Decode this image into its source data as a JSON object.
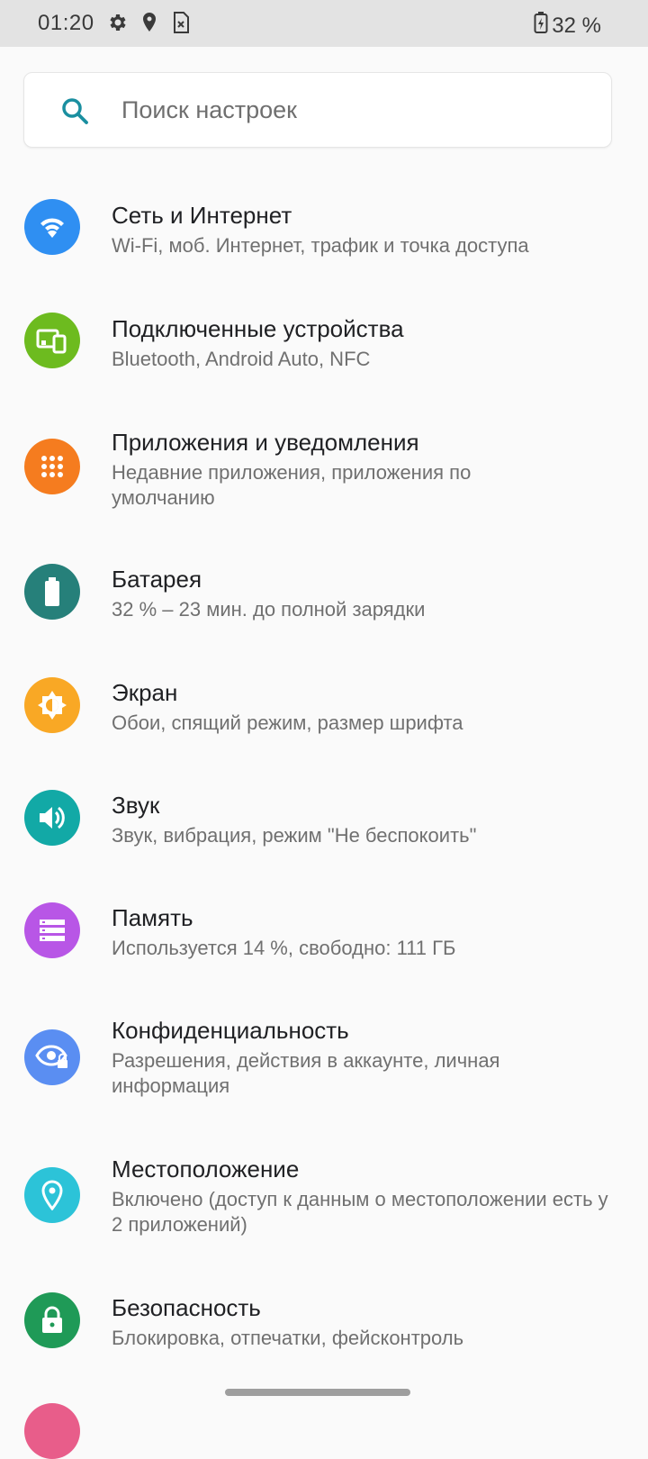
{
  "status_bar": {
    "time": "01:20",
    "battery_text": "32 %",
    "icons": [
      "gear-icon",
      "location-pin-icon",
      "sim-card-icon",
      "battery-charging-icon"
    ]
  },
  "search": {
    "placeholder": "Поиск настроек",
    "icon": "search-icon",
    "accent": "#1a8fa0"
  },
  "settings": {
    "items": [
      {
        "title": "Сеть и Интернет",
        "subtitle": "Wi-Fi, моб. Интернет, трафик и точка доступа",
        "icon": "wifi-icon",
        "color": "#2f8ff2"
      },
      {
        "title": "Подключенные устройства",
        "subtitle": "Bluetooth, Android Auto, NFC",
        "icon": "devices-icon",
        "color": "#6dbb1f"
      },
      {
        "title": "Приложения и уведомления",
        "subtitle": "Недавние приложения, приложения по умолчанию",
        "icon": "apps-grid-icon",
        "color": "#f57c1f"
      },
      {
        "title": "Батарея",
        "subtitle": "32 % – 23 мин. до полной зарядки",
        "icon": "battery-icon",
        "color": "#26807a"
      },
      {
        "title": "Экран",
        "subtitle": "Обои, спящий режим, размер шрифта",
        "icon": "brightness-icon",
        "color": "#f9a825"
      },
      {
        "title": "Звук",
        "subtitle": "Звук, вибрация, режим \"Не беспокоить\"",
        "icon": "volume-icon",
        "color": "#12a9a6"
      },
      {
        "title": "Память",
        "subtitle": "Используется 14 %, свободно: 111 ГБ",
        "icon": "storage-icon",
        "color": "#b856e6"
      },
      {
        "title": "Конфиденциальность",
        "subtitle": "Разрешения, действия в аккаунте, личная информация",
        "icon": "privacy-eye-icon",
        "color": "#5a8ef2"
      },
      {
        "title": "Местоположение",
        "subtitle": "Включено (доступ к данным о местоположении есть у 2 приложений)",
        "icon": "location-icon",
        "color": "#2cc3d8"
      },
      {
        "title": "Безопасность",
        "subtitle": "Блокировка, отпечатки, фейсконтроль",
        "icon": "lock-icon",
        "color": "#1f9a57"
      }
    ]
  }
}
